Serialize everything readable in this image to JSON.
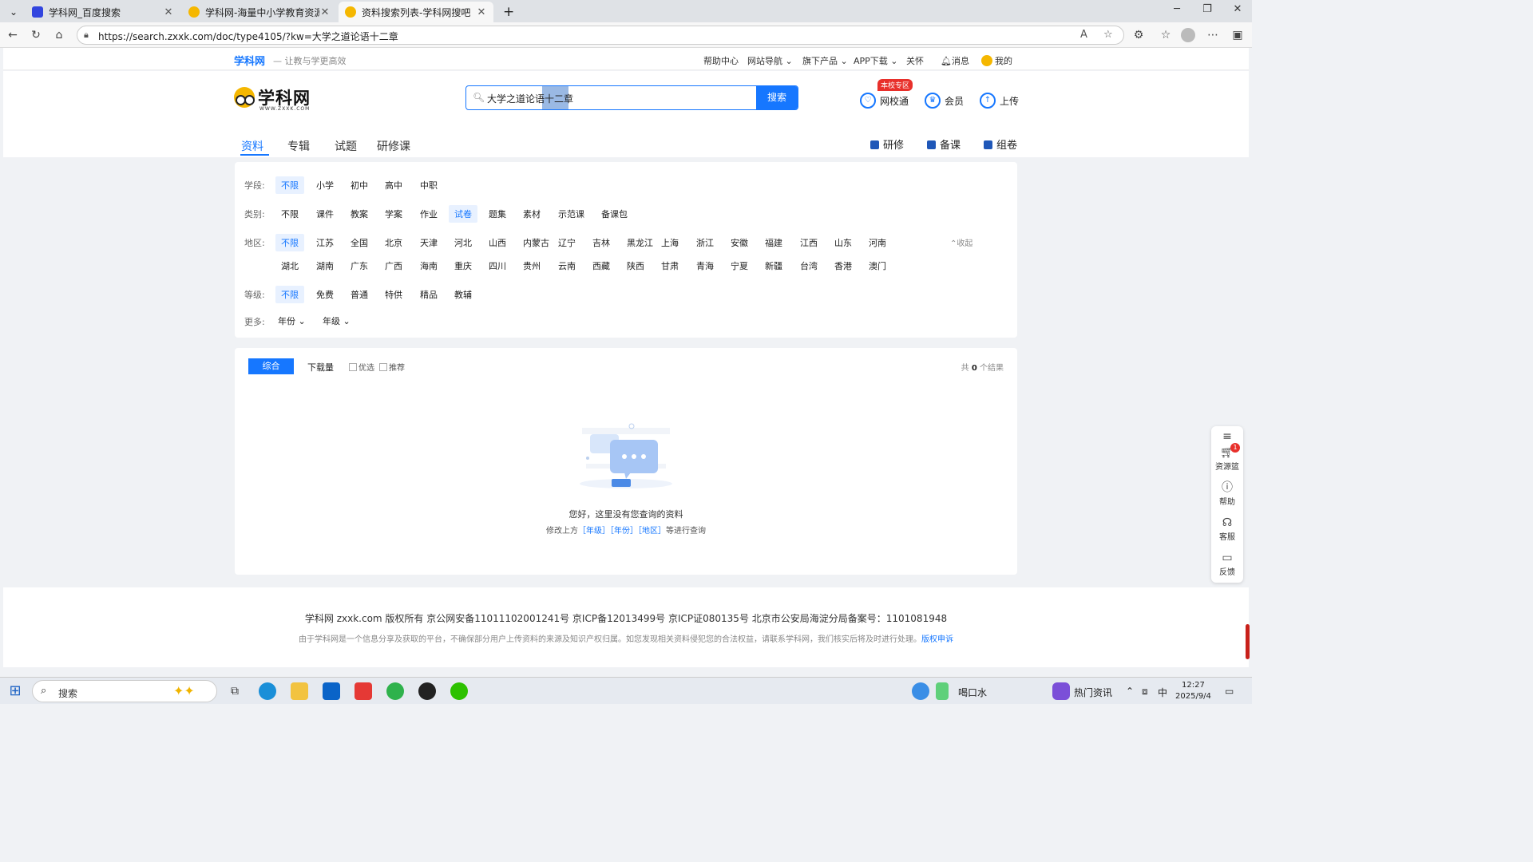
{
  "browser": {
    "tabs": [
      {
        "title": "学科网_百度搜索",
        "icon": "baidu-paw-icon"
      },
      {
        "title": "学科网-海量中小学教育资源共享",
        "icon": "zxxk-logo-icon"
      },
      {
        "title": "资料搜索列表-学科网搜吧",
        "icon": "zxxk-logo-icon"
      }
    ],
    "new_tab": "+",
    "url": "https://search.zxxk.com/doc/type4105/?kw=大学之道论语十二章"
  },
  "topbar": {
    "brand": "学科网",
    "slogan": "— 让教与学更高效",
    "links": [
      "帮助中心",
      "网站导航",
      "旗下产品",
      "APP下载",
      "关怀",
      "消息",
      "我的"
    ]
  },
  "header": {
    "logo_text": "学科网",
    "logo_sub": "WWW.ZXXK.COM",
    "search_value": "大学之道论语十二章",
    "search_button": "搜索",
    "badge": "本校专区",
    "actions": [
      "网校通",
      "会员",
      "上传"
    ],
    "nav_tabs": [
      "资料",
      "专辑",
      "试题",
      "研修课"
    ],
    "right_tabs": [
      "研修",
      "备课",
      "组卷"
    ]
  },
  "filters": {
    "stage": {
      "label": "学段:",
      "options": [
        "不限",
        "小学",
        "初中",
        "高中",
        "中职"
      ],
      "selected": "不限"
    },
    "category": {
      "label": "类别:",
      "options": [
        "不限",
        "课件",
        "教案",
        "学案",
        "作业",
        "试卷",
        "题集",
        "素材",
        "示范课",
        "备课包"
      ],
      "selected": "试卷"
    },
    "region": {
      "label": "地区:",
      "row1": [
        "不限",
        "江苏",
        "全国",
        "北京",
        "天津",
        "河北",
        "山西",
        "内蒙古",
        "辽宁",
        "吉林",
        "黑龙江",
        "上海",
        "浙江",
        "安徽",
        "福建",
        "江西",
        "山东",
        "河南"
      ],
      "row2": [
        "湖北",
        "湖南",
        "广东",
        "广西",
        "海南",
        "重庆",
        "四川",
        "贵州",
        "云南",
        "西藏",
        "陕西",
        "甘肃",
        "青海",
        "宁夏",
        "新疆",
        "台湾",
        "香港",
        "澳门"
      ],
      "selected": "不限",
      "collapse": "收起"
    },
    "level": {
      "label": "等级:",
      "options": [
        "不限",
        "免费",
        "普通",
        "特供",
        "精品",
        "教辅"
      ],
      "selected": "不限"
    },
    "more": {
      "label": "更多:",
      "dropdowns": [
        "年份",
        "年级"
      ]
    }
  },
  "results": {
    "sort": [
      "综合",
      "下载量"
    ],
    "checkboxes": [
      "优选",
      "推荐"
    ],
    "count_prefix": "共",
    "count": "0",
    "count_suffix": "个结果",
    "empty_msg": "您好，这里没有您查询的资料",
    "hint_prefix": "修改上方",
    "hint_links": [
      "［年级］",
      "［年份］",
      "［地区］"
    ],
    "hint_suffix": "等进行查询"
  },
  "footer": {
    "line1": "学科网 zxxk.com  版权所有 京公网安备11011102001241号  京ICP备12013499号 京ICP证080135号 北京市公安局海淀分局备案号：1101081948",
    "line2": "由于学科网是一个信息分享及获取的平台，不确保部分用户上传资料的来源及知识产权归属。如您发现相关资料侵犯您的合法权益，请联系学科网，我们核实后将及时进行处理。",
    "line2_link": "版权申诉"
  },
  "sidebar": {
    "items": [
      "资源篮",
      "帮助",
      "客服",
      "反馈"
    ],
    "cart_count": "1"
  },
  "taskbar": {
    "search": "搜索",
    "weather": "喝口水",
    "news": "热门资讯",
    "ime": "中",
    "time": "12:27",
    "date": "2025/9/4"
  }
}
